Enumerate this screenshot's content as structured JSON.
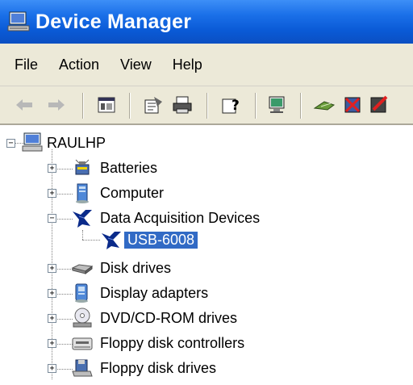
{
  "window": {
    "title": "Device Manager"
  },
  "menu": [
    "File",
    "Action",
    "View",
    "Help"
  ],
  "toolbar": {
    "buttons": [
      "back-icon",
      "forward-icon",
      "show-hide-tree-icon",
      "properties-icon",
      "print-icon",
      "help-icon",
      "scan-hardware-icon",
      "update-driver-icon",
      "uninstall-icon",
      "disable-icon"
    ]
  },
  "tree": {
    "root": "RAULHP",
    "nodes": [
      {
        "label": "Batteries",
        "icon": "battery-icon",
        "expanded": false
      },
      {
        "label": "Computer",
        "icon": "computer-icon",
        "expanded": false
      },
      {
        "label": "Data Acquisition Devices",
        "icon": "daq-icon",
        "expanded": true
      },
      {
        "label": "USB-6008",
        "icon": "daq-icon",
        "child": true,
        "selected": true
      },
      {
        "label": "Disk drives",
        "icon": "disk-drive-icon",
        "expanded": false
      },
      {
        "label": "Display adapters",
        "icon": "display-adapter-icon",
        "expanded": false
      },
      {
        "label": "DVD/CD-ROM drives",
        "icon": "dvd-drive-icon",
        "expanded": false
      },
      {
        "label": "Floppy disk controllers",
        "icon": "floppy-controller-icon",
        "expanded": false
      },
      {
        "label": "Floppy disk drives",
        "icon": "floppy-drive-icon",
        "expanded": false
      }
    ]
  }
}
